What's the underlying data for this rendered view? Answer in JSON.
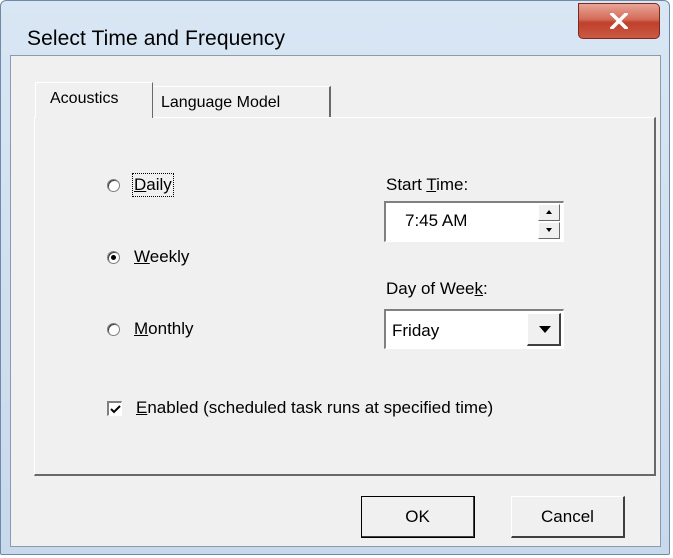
{
  "window": {
    "title": "Select Time and Frequency"
  },
  "tabs": [
    {
      "label": "Acoustics",
      "selected": true
    },
    {
      "label": "Language Model",
      "selected": false
    }
  ],
  "frequency": {
    "options": [
      {
        "accel": "D",
        "rest": "aily",
        "checked": false
      },
      {
        "accel": "W",
        "rest": "eekly",
        "checked": true
      },
      {
        "accel": "M",
        "rest": "onthly",
        "checked": false
      }
    ]
  },
  "start_time": {
    "label_pre": "Start ",
    "label_accel": "T",
    "label_post": "ime:",
    "value": "7:45 AM"
  },
  "day_of_week": {
    "label_pre": "Day of Wee",
    "label_accel": "k",
    "label_post": ":",
    "value": "Friday"
  },
  "enabled": {
    "accel": "E",
    "rest": "nabled (scheduled task runs at specified time)",
    "checked": true
  },
  "buttons": {
    "ok": "OK",
    "cancel": "Cancel"
  }
}
